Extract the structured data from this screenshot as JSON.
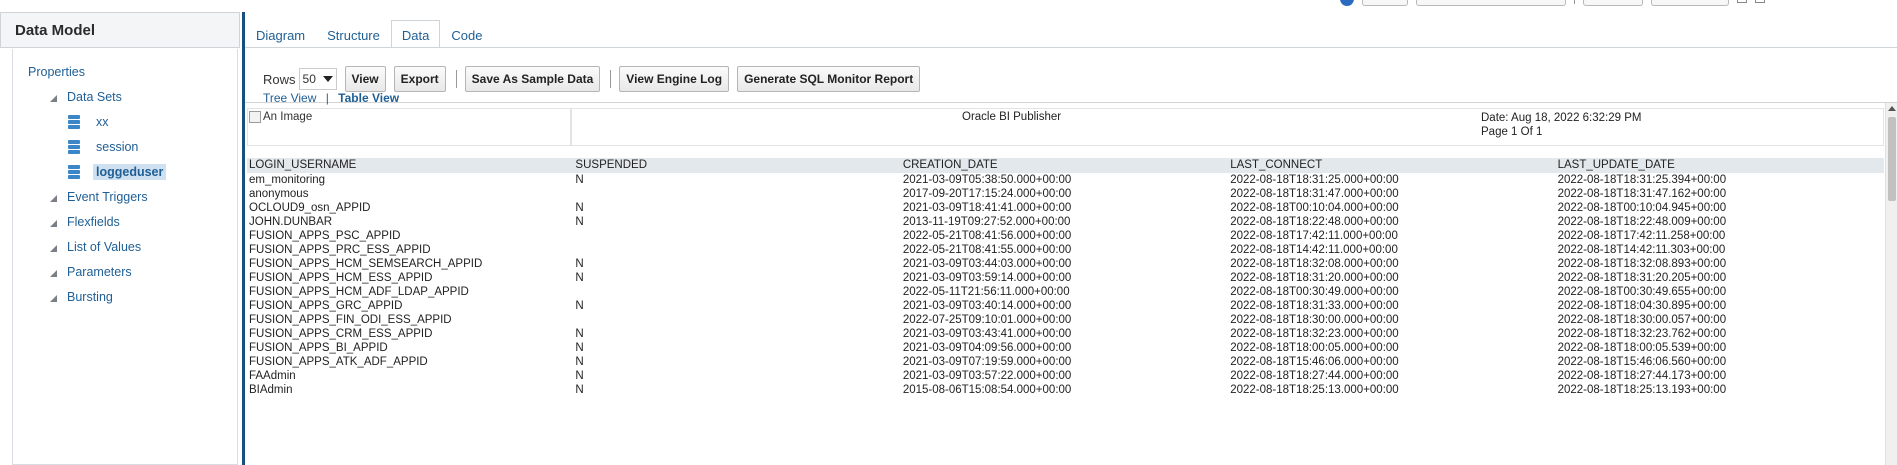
{
  "left_panel": {
    "title": "Data Model",
    "items": [
      {
        "label": "Properties"
      },
      {
        "label": "Data Sets"
      },
      {
        "label": "xx"
      },
      {
        "label": "session"
      },
      {
        "label": "loggeduser"
      },
      {
        "label": "Event Triggers"
      },
      {
        "label": "Flexfields"
      },
      {
        "label": "List of Values"
      },
      {
        "label": "Parameters"
      },
      {
        "label": "Bursting"
      }
    ]
  },
  "tabs": [
    {
      "label": "Diagram"
    },
    {
      "label": "Structure"
    },
    {
      "label": "Data"
    },
    {
      "label": "Code"
    }
  ],
  "toolbar": {
    "rows_label": "Rows",
    "rows_value": "50",
    "view_label": "View",
    "export_label": "Export",
    "save_sample_label": "Save As Sample Data",
    "engine_log_label": "View Engine Log",
    "sql_monitor_label": "Generate SQL Monitor Report"
  },
  "view_links": {
    "tree": "Tree View",
    "separator": "|",
    "table": "Table View"
  },
  "report": {
    "image_alt": "An Image",
    "title": "Oracle BI Publisher",
    "date": "Date: Aug 18, 2022 6:32:29 PM",
    "page": "Page 1 Of 1"
  },
  "table": {
    "columns": [
      "LOGIN_USERNAME",
      "SUSPENDED",
      "CREATION_DATE",
      "LAST_CONNECT",
      "LAST_UPDATE_DATE"
    ],
    "rows": [
      [
        "em_monitoring",
        "N",
        "2021-03-09T05:38:50.000+00:00",
        "2022-08-18T18:31:25.000+00:00",
        "2022-08-18T18:31:25.394+00:00"
      ],
      [
        "anonymous",
        "",
        "2017-09-20T17:15:24.000+00:00",
        "2022-08-18T18:31:47.000+00:00",
        "2022-08-18T18:31:47.162+00:00"
      ],
      [
        "OCLOUD9_osn_APPID",
        "N",
        "2021-03-09T18:41:41.000+00:00",
        "2022-08-18T00:10:04.000+00:00",
        "2022-08-18T00:10:04.945+00:00"
      ],
      [
        "JOHN.DUNBAR",
        "N",
        "2013-11-19T09:27:52.000+00:00",
        "2022-08-18T18:22:48.000+00:00",
        "2022-08-18T18:22:48.009+00:00"
      ],
      [
        "FUSION_APPS_PSC_APPID",
        "",
        "2022-05-21T08:41:56.000+00:00",
        "2022-08-18T17:42:11.000+00:00",
        "2022-08-18T17:42:11.258+00:00"
      ],
      [
        "FUSION_APPS_PRC_ESS_APPID",
        "",
        "2022-05-21T08:41:55.000+00:00",
        "2022-08-18T14:42:11.000+00:00",
        "2022-08-18T14:42:11.303+00:00"
      ],
      [
        "FUSION_APPS_HCM_SEMSEARCH_APPID",
        "N",
        "2021-03-09T03:44:03.000+00:00",
        "2022-08-18T18:32:08.000+00:00",
        "2022-08-18T18:32:08.893+00:00"
      ],
      [
        "FUSION_APPS_HCM_ESS_APPID",
        "N",
        "2021-03-09T03:59:14.000+00:00",
        "2022-08-18T18:31:20.000+00:00",
        "2022-08-18T18:31:20.205+00:00"
      ],
      [
        "FUSION_APPS_HCM_ADF_LDAP_APPID",
        "",
        "2022-05-11T21:56:11.000+00:00",
        "2022-08-18T00:30:49.000+00:00",
        "2022-08-18T00:30:49.655+00:00"
      ],
      [
        "FUSION_APPS_GRC_APPID",
        "N",
        "2021-03-09T03:40:14.000+00:00",
        "2022-08-18T18:31:33.000+00:00",
        "2022-08-18T18:04:30.895+00:00"
      ],
      [
        "FUSION_APPS_FIN_ODI_ESS_APPID",
        "",
        "2022-07-25T09:10:01.000+00:00",
        "2022-08-18T18:30:00.000+00:00",
        "2022-08-18T18:30:00.057+00:00"
      ],
      [
        "FUSION_APPS_CRM_ESS_APPID",
        "N",
        "2021-03-09T03:43:41.000+00:00",
        "2022-08-18T18:32:23.000+00:00",
        "2022-08-18T18:32:23.762+00:00"
      ],
      [
        "FUSION_APPS_BI_APPID",
        "N",
        "2021-03-09T04:09:56.000+00:00",
        "2022-08-18T18:00:05.000+00:00",
        "2022-08-18T18:00:05.539+00:00"
      ],
      [
        "FUSION_APPS_ATK_ADF_APPID",
        "N",
        "2021-03-09T07:19:59.000+00:00",
        "2022-08-18T15:46:06.000+00:00",
        "2022-08-18T15:46:06.560+00:00"
      ],
      [
        "FAAdmin",
        "N",
        "2021-03-09T03:57:22.000+00:00",
        "2022-08-18T18:27:44.000+00:00",
        "2022-08-18T18:27:44.173+00:00"
      ],
      [
        "BIAdmin",
        "N",
        "2015-08-06T15:08:54.000+00:00",
        "2022-08-18T18:25:13.000+00:00",
        "2022-08-18T18:25:13.193+00:00"
      ]
    ]
  },
  "colors": {
    "link": "#1f5f95",
    "divider": "#174f7e",
    "header_row": "#e3e8ed",
    "selected_item": "#cfe0f1"
  }
}
